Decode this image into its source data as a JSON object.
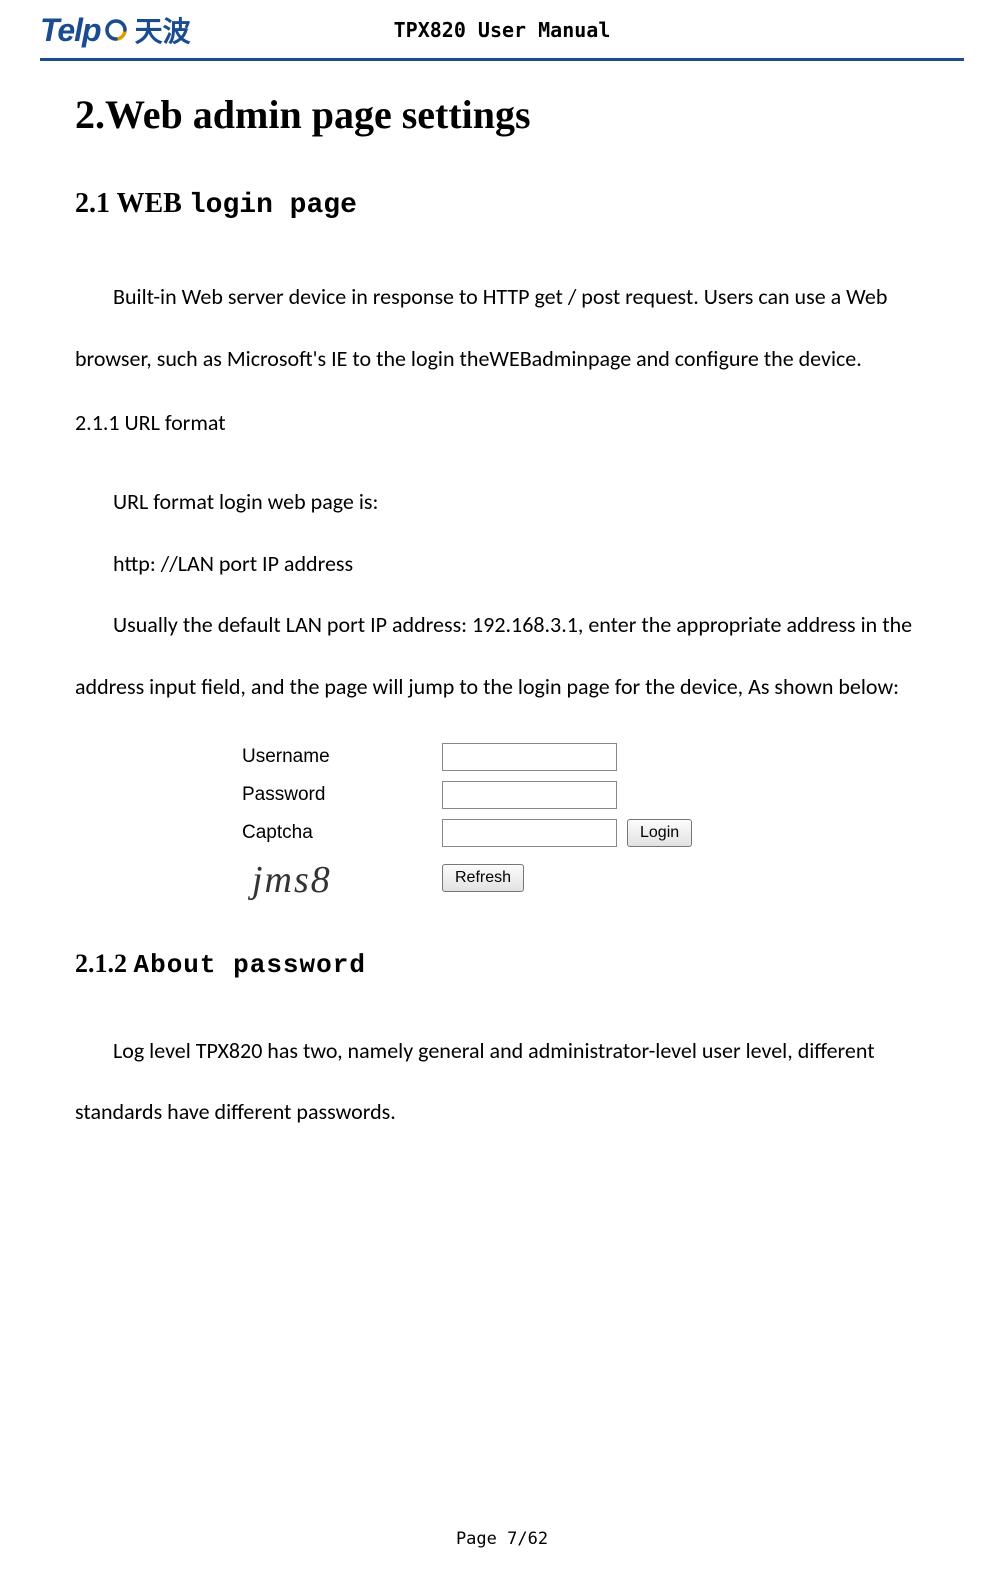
{
  "header": {
    "logo_main": "Telp",
    "logo_cn": "天波",
    "title": "TPX820 User Manual"
  },
  "content": {
    "h1": "2.Web admin page settings",
    "h2_prefix": "2.1 WEB ",
    "h2_mono": "login page",
    "para1": "Built-in Web server device in  response  to HTTP  get  /  post request. Users can use a Web browser, such as Microsoft's IE to the login theWEBadminpage and configure the device.",
    "sub211": "2.1.1 URL format",
    "para2a": "URL format login web page is:",
    "para2b": "http: //LAN port IP address",
    "para2c": "Usually the default LAN port IP address: 192.168.3.1, enter the appropriate address in the address input field, and the page will jump to the login page for the device, As shown below:",
    "form": {
      "username_label": "Username",
      "password_label": "Password",
      "captcha_label": "Captcha",
      "login_button": "Login",
      "captcha_text": "jms8",
      "refresh_button": "Refresh"
    },
    "h3_prefix": "2.1.2 ",
    "h3_mono": "About password",
    "para3": "Log  level TPX820 has  two,  namely  general  and  administrator-level  user level, different standards have different passwords."
  },
  "footer": "Page 7/62"
}
